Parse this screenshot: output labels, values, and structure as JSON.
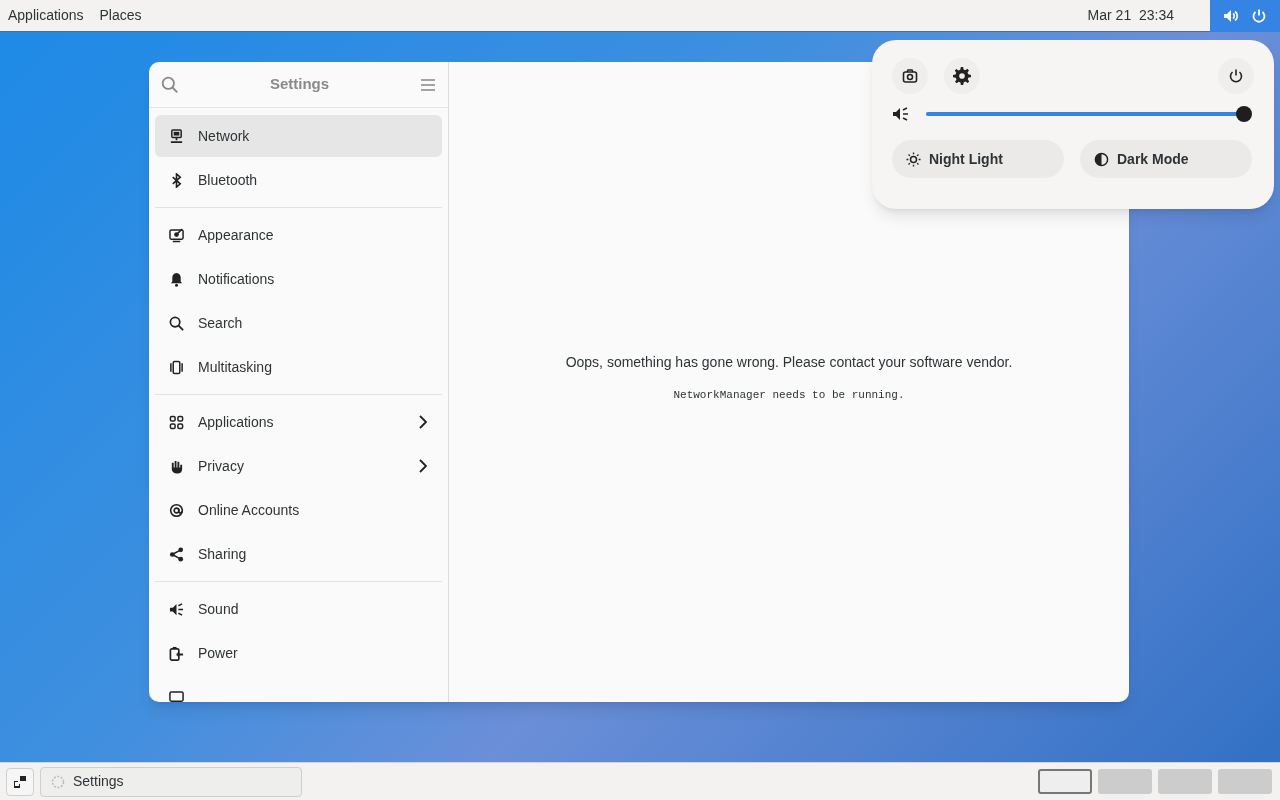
{
  "top_bar": {
    "menus": [
      "Applications",
      "Places"
    ],
    "clock": "Mar 21  23:34"
  },
  "settings_window": {
    "title": "Settings",
    "sidebar": [
      [
        {
          "label": "Network",
          "selected": true,
          "submenu": false
        },
        {
          "label": "Bluetooth",
          "selected": false,
          "submenu": false
        }
      ],
      [
        {
          "label": "Appearance",
          "selected": false,
          "submenu": false
        },
        {
          "label": "Notifications",
          "selected": false,
          "submenu": false
        },
        {
          "label": "Search",
          "selected": false,
          "submenu": false
        },
        {
          "label": "Multitasking",
          "selected": false,
          "submenu": false
        }
      ],
      [
        {
          "label": "Applications",
          "selected": false,
          "submenu": true
        },
        {
          "label": "Privacy",
          "selected": false,
          "submenu": true
        },
        {
          "label": "Online Accounts",
          "selected": false,
          "submenu": false
        },
        {
          "label": "Sharing",
          "selected": false,
          "submenu": false
        }
      ],
      [
        {
          "label": "Sound",
          "selected": false,
          "submenu": false
        },
        {
          "label": "Power",
          "selected": false,
          "submenu": false
        }
      ]
    ],
    "error_message": "Oops, something has gone wrong. Please contact your software vendor.",
    "error_detail": "NetworkManager needs to be running."
  },
  "quick_settings": {
    "volume": {
      "level": 0.98
    },
    "toggles": [
      {
        "label": "Night Light",
        "on": false
      },
      {
        "label": "Dark Mode",
        "on": false
      }
    ]
  },
  "taskbar": {
    "window_button": "Settings",
    "workspaces": [
      {
        "selected": true
      },
      {
        "selected": false
      },
      {
        "selected": false
      },
      {
        "selected": false
      }
    ]
  }
}
